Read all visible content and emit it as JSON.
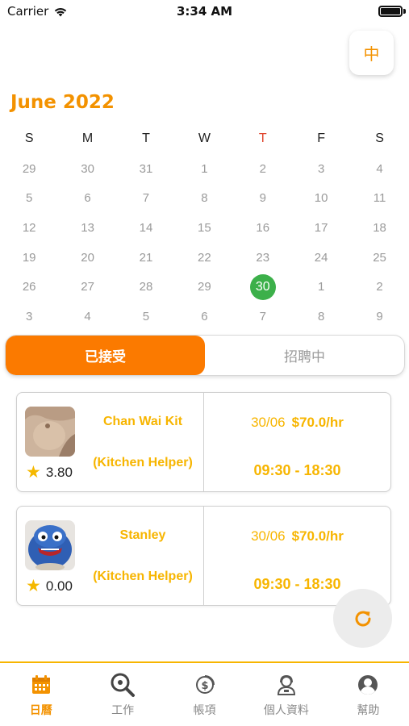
{
  "status_bar": {
    "carrier": "Carrier",
    "time": "3:34 AM"
  },
  "language_button": {
    "label": "中"
  },
  "calendar": {
    "month_title": "June 2022",
    "weekdays": [
      "S",
      "M",
      "T",
      "W",
      "T",
      "F",
      "S"
    ],
    "today_weekday_index": 4,
    "weeks": [
      [
        "29",
        "30",
        "31",
        "1",
        "2",
        "3",
        "4"
      ],
      [
        "5",
        "6",
        "7",
        "8",
        "9",
        "10",
        "11"
      ],
      [
        "12",
        "13",
        "14",
        "15",
        "16",
        "17",
        "18"
      ],
      [
        "19",
        "20",
        "21",
        "22",
        "23",
        "24",
        "25"
      ],
      [
        "26",
        "27",
        "28",
        "29",
        "30",
        "1",
        "2"
      ],
      [
        "3",
        "4",
        "5",
        "6",
        "7",
        "8",
        "9"
      ]
    ],
    "selected_day": "30",
    "colors": {
      "accent": "#f39200",
      "today": "#3cb04a",
      "today_header": "#e0462f"
    }
  },
  "segments": {
    "accepted": "已接受",
    "recruiting": "招聘中",
    "active": "accepted"
  },
  "jobs": [
    {
      "name": "Chan Wai Kit",
      "role": "(Kitchen Helper)",
      "rating": "3.80",
      "date": "30/06",
      "rate": "$70.0/hr",
      "time": "09:30 - 18:30",
      "avatar_icon": "worker-photo"
    },
    {
      "name": "Stanley",
      "role": "(Kitchen Helper)",
      "rating": "0.00",
      "date": "30/06",
      "rate": "$70.0/hr",
      "time": "09:30 - 18:30",
      "avatar_icon": "blue-plush-toy-photo"
    }
  ],
  "refresh_button": {
    "icon": "refresh-icon"
  },
  "tab_bar": {
    "items": [
      {
        "label": "日曆",
        "icon": "calendar-icon",
        "active": true
      },
      {
        "label": "工作",
        "icon": "search-icon",
        "active": false
      },
      {
        "label": "帳項",
        "icon": "dollar-icon",
        "active": false
      },
      {
        "label": "個人資料",
        "icon": "profile-icon",
        "active": false
      },
      {
        "label": "幫助",
        "icon": "user-circle-icon",
        "active": false
      }
    ]
  }
}
